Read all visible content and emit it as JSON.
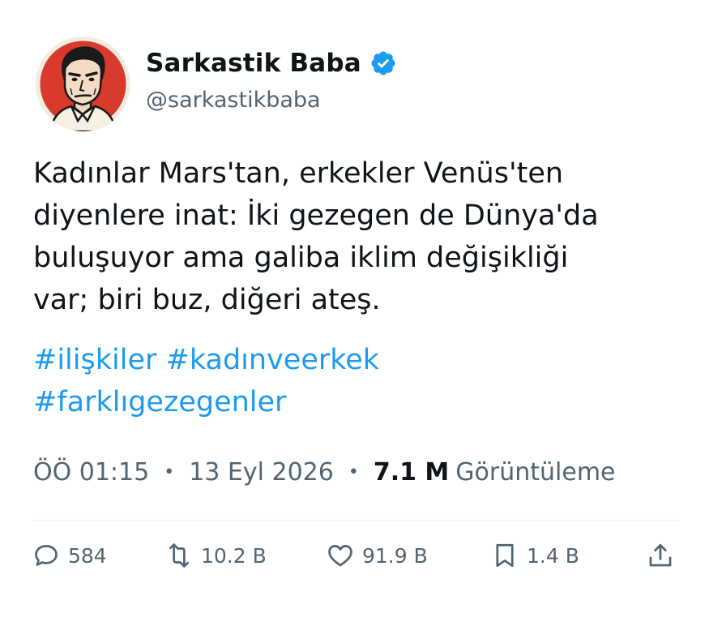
{
  "author": {
    "name": "Sarkastik Baba",
    "handle": "@sarkastikbaba",
    "verified_color": "#1d9bf0"
  },
  "tweet": {
    "text_lines": [
      "Kadınlar Mars'tan, erkekler Venüs'ten",
      "diyenlere inat: İki gezegen de Dünya'da",
      "buluşuyor ama galiba iklim değişikliği",
      "var; biri buz, diğeri ateş."
    ],
    "hashtags": [
      "#ilişkiler",
      "#kadınveerkek",
      "#farklıgezegenler"
    ]
  },
  "meta": {
    "time": "ÖÖ 01:15",
    "date": "13 Eyl 2026",
    "views_count": "7.1 M",
    "views_label": "Görüntüleme",
    "separator": "•"
  },
  "actions": {
    "replies": "584",
    "retweets": "10.2 B",
    "likes": "91.9 B",
    "bookmarks": "1.4 B"
  },
  "colors": {
    "text": "#0f1419",
    "secondary": "#536471",
    "link": "#1d9bf0",
    "avatar_bg": "#d83a2c"
  }
}
